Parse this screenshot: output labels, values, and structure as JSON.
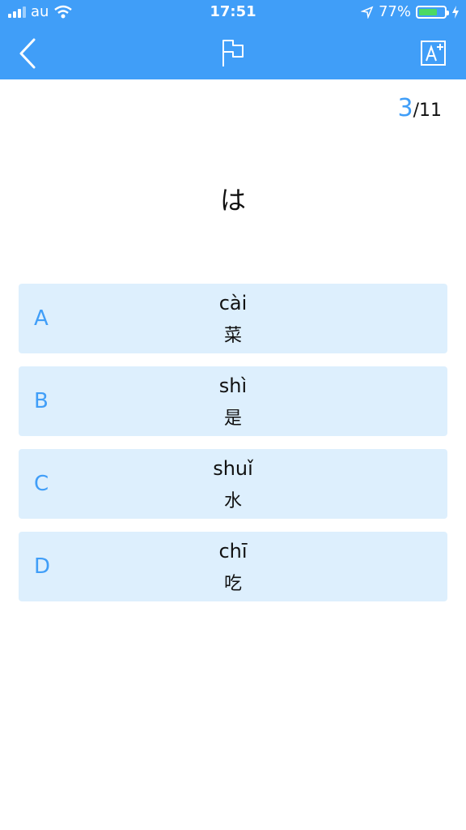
{
  "status": {
    "carrier": "au",
    "time": "17:51",
    "battery": "77%",
    "battery_level": 0.77
  },
  "nav": {
    "back_icon": "chevron-left-icon",
    "flag_icon": "flag-icon",
    "font_icon": "font-size-icon"
  },
  "progress": {
    "current": "3",
    "total": "/11"
  },
  "question": "は",
  "options": [
    {
      "letter": "A",
      "pinyin": "cài",
      "hanzi": "菜"
    },
    {
      "letter": "B",
      "pinyin": "shì",
      "hanzi": "是"
    },
    {
      "letter": "C",
      "pinyin": "shuǐ",
      "hanzi": "水"
    },
    {
      "letter": "D",
      "pinyin": "chī",
      "hanzi": "吃"
    }
  ],
  "colors": {
    "accent": "#409EF8",
    "option_bg": "#DDEFFD",
    "battery": "#4cd964"
  }
}
